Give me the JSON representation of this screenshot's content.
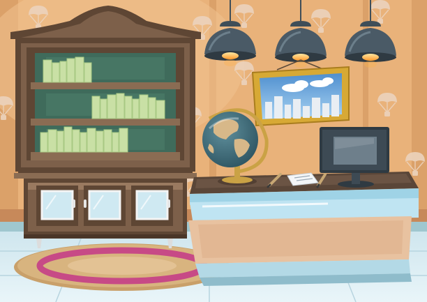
{
  "scene": {
    "kind": "cartoon office room interior",
    "objects": [
      "wallpaper-parachute-pattern",
      "ceiling-lamp",
      "bookcase-cabinet",
      "framed-city-painting",
      "desk-globe",
      "pencil",
      "paper-document",
      "computer-monitor",
      "reception-desk",
      "round-rug",
      "tiled-floor"
    ],
    "lamp_count": 3,
    "bookshelf_rows": 3,
    "cabinet_doors": 3
  },
  "colors": {
    "wall": "#e9b27a",
    "wall_stripe": "#dba169",
    "wall_base": "#c7895a",
    "baseboard": "#9fc7cf",
    "floor": "#cfe6ee",
    "floor_line": "#b7d4df",
    "wood_dark": "#5e4634",
    "wood_mid": "#7d604a",
    "wood_light": "#9a7a60",
    "shelf_back": "#3f6b5b",
    "book": "#c9e0a5",
    "book_shade": "#a8c983",
    "lamp": "#3f4e58",
    "lamp_glow": "#ffb347",
    "frame_gold": "#d7a935",
    "sky": "#6fa7d8",
    "globe_ocean": "#3d6a78",
    "globe_land": "#d7b889",
    "brass": "#caa245",
    "desk_top": "#5a4638",
    "desk_glass": "#bfe4f2",
    "desk_wood": "#e8c2a0",
    "monitor": "#2f3a42",
    "rug_outer": "#d8b47f",
    "rug_ring": "#c74a86"
  }
}
